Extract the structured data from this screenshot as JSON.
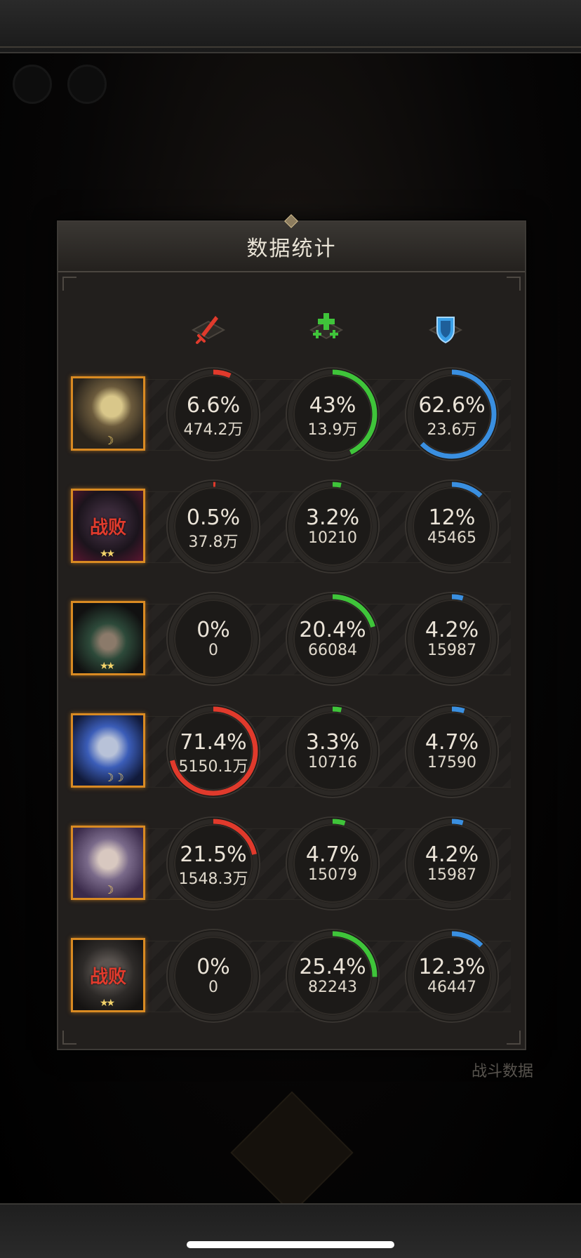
{
  "panel": {
    "title": "数据统计",
    "columns": [
      {
        "icon": "damage-sword-icon",
        "color": "#e03a2c"
      },
      {
        "icon": "heal-plus-icon",
        "color": "#3fc43a"
      },
      {
        "icon": "shield-icon",
        "color": "#3a8fe0"
      }
    ]
  },
  "background": {
    "battle_data_label": "战斗数据"
  },
  "rows": [
    {
      "hero": "hero-blonde-warrior",
      "status": "",
      "rank": "moon-1",
      "stats": [
        {
          "pct_label": "6.6%",
          "value": "474.2万",
          "fraction": 0.066
        },
        {
          "pct_label": "43%",
          "value": "13.9万",
          "fraction": 0.43
        },
        {
          "pct_label": "62.6%",
          "value": "23.6万",
          "fraction": 0.626
        }
      ]
    },
    {
      "hero": "hero-dark-mage",
      "status": "战败",
      "rank": "star-2",
      "stats": [
        {
          "pct_label": "0.5%",
          "value": "37.8万",
          "fraction": 0.005
        },
        {
          "pct_label": "3.2%",
          "value": "10210",
          "fraction": 0.032
        },
        {
          "pct_label": "12%",
          "value": "45465",
          "fraction": 0.12
        }
      ]
    },
    {
      "hero": "hero-antlered-elf",
      "status": "",
      "rank": "star-2",
      "stats": [
        {
          "pct_label": "0%",
          "value": "0",
          "fraction": 0
        },
        {
          "pct_label": "20.4%",
          "value": "66084",
          "fraction": 0.204
        },
        {
          "pct_label": "4.2%",
          "value": "15987",
          "fraction": 0.042
        }
      ]
    },
    {
      "hero": "hero-ice-knight",
      "status": "",
      "rank": "moon-2",
      "stats": [
        {
          "pct_label": "71.4%",
          "value": "5150.1万",
          "fraction": 0.714
        },
        {
          "pct_label": "3.3%",
          "value": "10716",
          "fraction": 0.033
        },
        {
          "pct_label": "4.7%",
          "value": "17590",
          "fraction": 0.047
        }
      ]
    },
    {
      "hero": "hero-silver-elf",
      "status": "",
      "rank": "moon-1",
      "stats": [
        {
          "pct_label": "21.5%",
          "value": "1548.3万",
          "fraction": 0.215
        },
        {
          "pct_label": "4.7%",
          "value": "15079",
          "fraction": 0.047
        },
        {
          "pct_label": "4.2%",
          "value": "15987",
          "fraction": 0.042
        }
      ]
    },
    {
      "hero": "hero-armored-golem",
      "status": "战败",
      "rank": "star-2",
      "stats": [
        {
          "pct_label": "0%",
          "value": "0",
          "fraction": 0
        },
        {
          "pct_label": "25.4%",
          "value": "82243",
          "fraction": 0.254
        },
        {
          "pct_label": "12.3%",
          "value": "46447",
          "fraction": 0.123
        }
      ]
    }
  ]
}
